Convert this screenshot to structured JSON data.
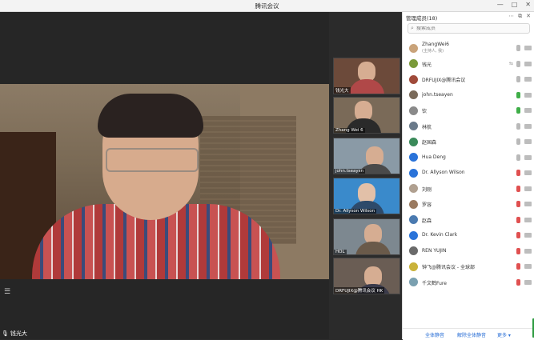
{
  "window": {
    "title": "腾讯会议",
    "controls": [
      "—",
      "□",
      "✕"
    ]
  },
  "stage": {
    "speaker_name": "钱光大",
    "menu_icon": "list-icon"
  },
  "thumbnails": [
    {
      "name": "钱光大",
      "bg": "#6c4a3a"
    },
    {
      "name": "Zhang Wei 6",
      "bg": "#7a6a58"
    },
    {
      "name": "john.tseaysn",
      "bg": "#8a9aa6"
    },
    {
      "name": "Dr. Allyson Wilson",
      "bg": "#3a8acb"
    },
    {
      "name": "HOL",
      "bg": "#7d8890"
    },
    {
      "name": "DRFUJIX@腾讯会议 HK",
      "bg": "#6a5d54"
    }
  ],
  "panel": {
    "title": "管理成员(18)",
    "search_placeholder": "搜索成员",
    "header_icons": [
      "more-icon",
      "popout-icon",
      "close-icon"
    ],
    "members": [
      {
        "name": "ZhangWei6",
        "sub": "(主持人, 我)",
        "avatar": "#c9a37a",
        "mic": "#b9b9b9"
      },
      {
        "name": "钱光",
        "sub": "",
        "avatar": "#7a9a3a",
        "mic": "#b9b9b9",
        "extra": "⇆"
      },
      {
        "name": "DRFUJIX@腾讯会议",
        "sub": "",
        "avatar": "#a04a3a",
        "mic": "#b9b9b9"
      },
      {
        "name": "john.tseayen",
        "sub": "",
        "avatar": "#7a6a5a",
        "mic": "#3fae48"
      },
      {
        "name": "钦",
        "sub": "",
        "avatar": "#8a8a8a",
        "mic": "#3fae48"
      },
      {
        "name": "林航",
        "sub": "",
        "avatar": "#6a7a8a",
        "mic": "#b9b9b9"
      },
      {
        "name": "赵国森",
        "sub": "",
        "avatar": "#3a8a5a",
        "mic": "#b9b9b9"
      },
      {
        "name": "Hua Deng",
        "sub": "",
        "avatar": "#2a73d9",
        "mic": "#b9b9b9"
      },
      {
        "name": "Dr. Allyson Wilson",
        "sub": "",
        "avatar": "#2a73d9",
        "mic": "#e05050"
      },
      {
        "name": "刘刚",
        "sub": "",
        "avatar": "#b0a090",
        "mic": "#e05050"
      },
      {
        "name": "罗容",
        "sub": "",
        "avatar": "#9a7a60",
        "mic": "#e05050"
      },
      {
        "name": "赵森",
        "sub": "",
        "avatar": "#4a7ab0",
        "mic": "#e05050"
      },
      {
        "name": "Dr. Kevin Clark",
        "sub": "",
        "avatar": "#2a73d9",
        "mic": "#e05050"
      },
      {
        "name": "REN YUJIN",
        "sub": "",
        "avatar": "#6a6a6a",
        "mic": "#e05050"
      },
      {
        "name": "钟飞@腾讯会议 - 全球部",
        "sub": "",
        "avatar": "#c9b23a",
        "mic": "#e05050"
      },
      {
        "name": "千文鹤Fure",
        "sub": "",
        "avatar": "#7aa0b0",
        "mic": "#e05050"
      }
    ],
    "footer": {
      "mute_all": "全体静音",
      "unmute_all": "解除全体静音",
      "more": "更多 ▾"
    }
  }
}
